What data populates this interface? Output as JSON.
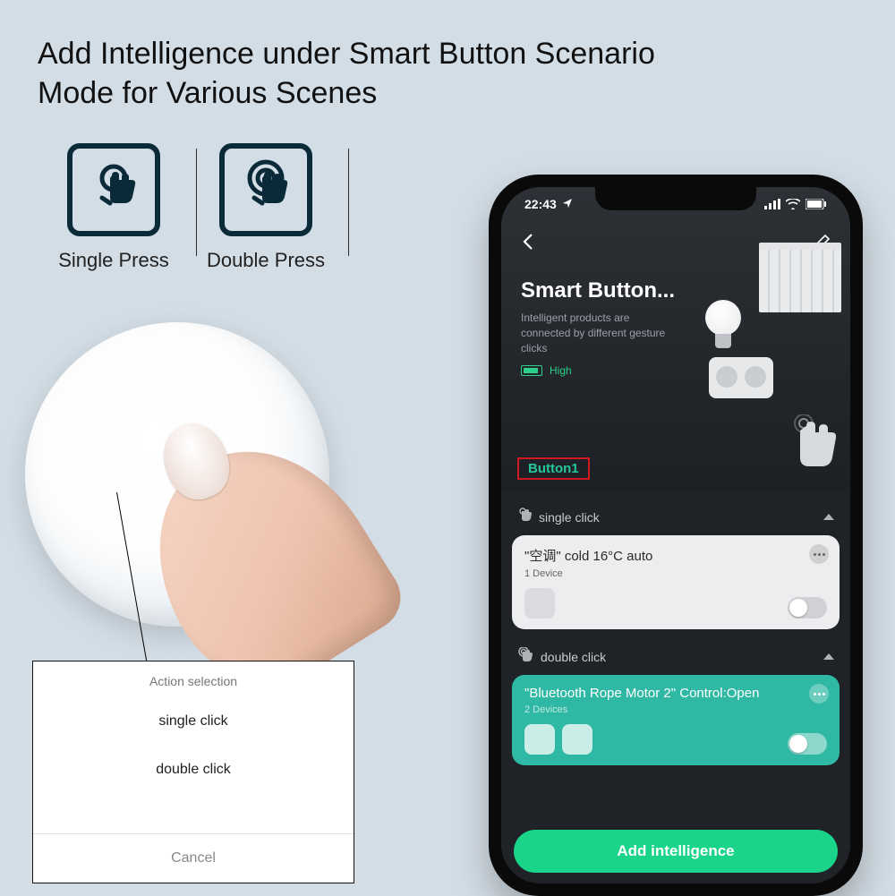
{
  "headline": "Add Intelligence under Smart Button Scenario Mode for Various Scenes",
  "press": {
    "single": "Single Press",
    "double": "Double Press"
  },
  "action_sheet": {
    "title": "Action selection",
    "single": "single click",
    "double": "double click",
    "cancel": "Cancel"
  },
  "phone": {
    "statusbar": {
      "time": "22:43"
    },
    "hero": {
      "title": "Smart Button...",
      "subtitle": "Intelligent products are connected by different gesture clicks",
      "battery_label": "High"
    },
    "tab_label": "Button1",
    "sections": {
      "single": {
        "header": "single click",
        "card": {
          "title": "\"空调\" cold 16°C auto",
          "subtitle": "1 Device"
        }
      },
      "double": {
        "header": "double click",
        "card": {
          "title": "\"Bluetooth Rope Motor 2\" Control:Open",
          "subtitle": "2 Devices"
        }
      }
    },
    "cta": "Add intelligence"
  }
}
